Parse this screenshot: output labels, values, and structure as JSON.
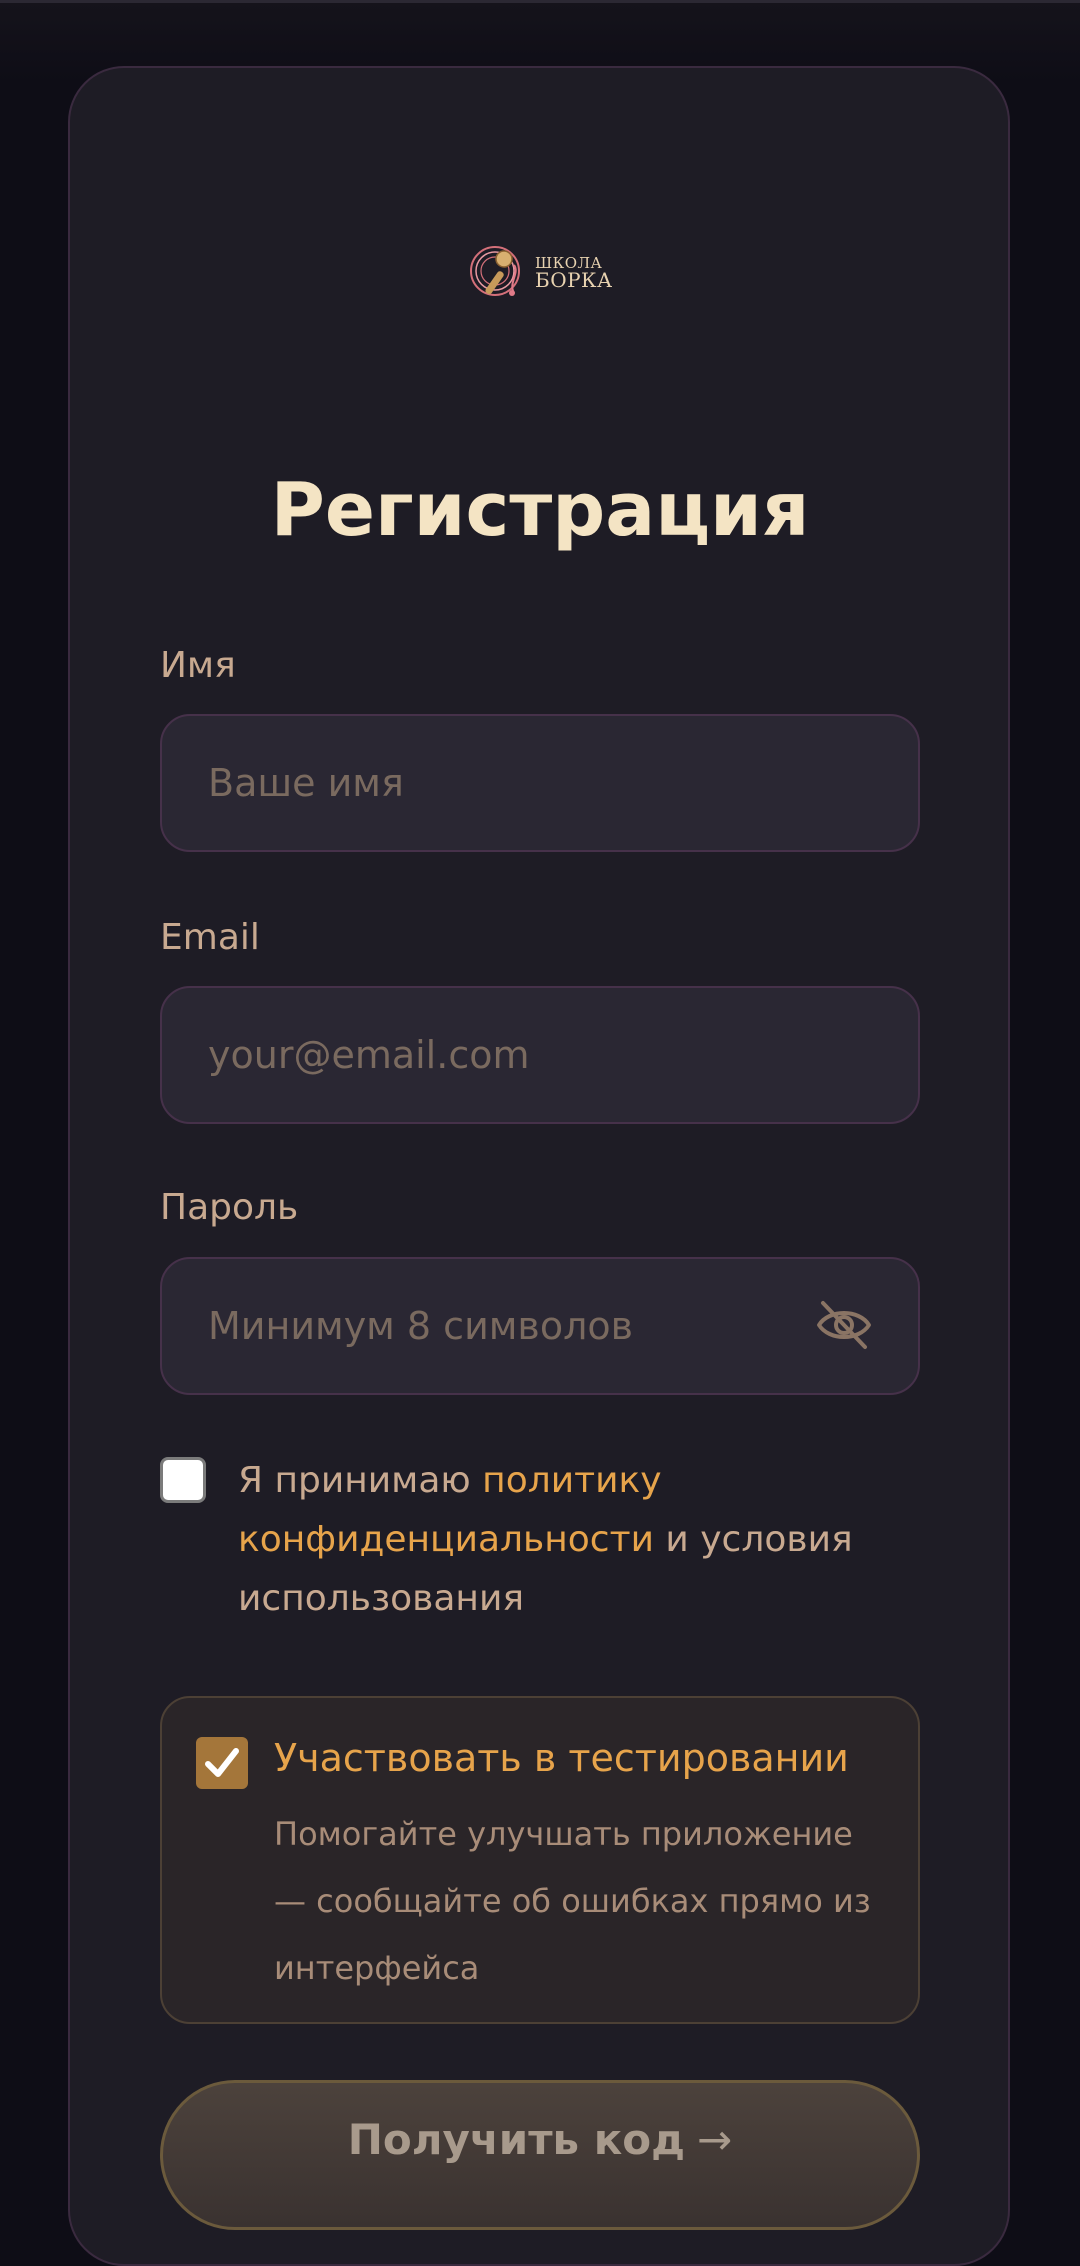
{
  "brand": {
    "line1": "ШКОЛА",
    "line2": "БОРКА"
  },
  "title": "Регистрация",
  "fields": {
    "name": {
      "label": "Имя",
      "placeholder": "Ваше имя",
      "value": ""
    },
    "email": {
      "label": "Email",
      "placeholder": "your@email.com",
      "value": ""
    },
    "password": {
      "label": "Пароль",
      "placeholder": "Минимум 8 символов",
      "value": "",
      "toggle_icon": "eye-off-icon"
    }
  },
  "privacy": {
    "checked": false,
    "text_before": "Я принимаю ",
    "link_text": "политику конфиденциальности",
    "text_after": " и условия использования"
  },
  "beta": {
    "checked": true,
    "title": "Участвовать в тестировании",
    "description": "Помогайте улучшать приложение — сообщайте об ошибках прямо из интерфейса"
  },
  "submit": {
    "label": "Получить код",
    "arrow": "→"
  },
  "colors": {
    "background": "#0e0d16",
    "card": "#1e1c25",
    "accent": "#e7a44b",
    "title": "#f4e4c4",
    "label": "#c8a990"
  }
}
